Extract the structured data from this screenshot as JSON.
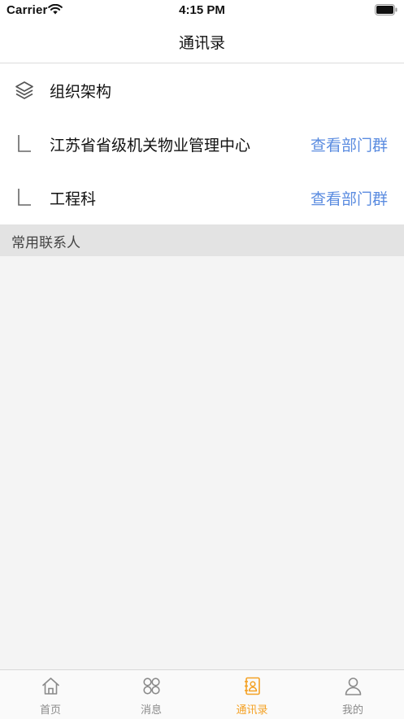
{
  "status_bar": {
    "carrier": "Carrier",
    "time": "4:15 PM"
  },
  "nav": {
    "title": "通讯录"
  },
  "org": {
    "header": {
      "label": "组织架构",
      "icon": "layers-icon"
    },
    "departments": [
      {
        "name": "江苏省省级机关物业管理中心",
        "action": "查看部门群"
      },
      {
        "name": "工程科",
        "action": "查看部门群"
      }
    ]
  },
  "favorites": {
    "title": "常用联系人"
  },
  "tabs": [
    {
      "label": "首页",
      "icon": "home-icon",
      "active": false
    },
    {
      "label": "消息",
      "icon": "message-icon",
      "active": false
    },
    {
      "label": "通讯录",
      "icon": "contacts-icon",
      "active": true
    },
    {
      "label": "我的",
      "icon": "profile-icon",
      "active": false
    }
  ],
  "colors": {
    "accent": "#f4a124",
    "link": "#5b8ce0",
    "section_bg": "#e3e3e3"
  }
}
